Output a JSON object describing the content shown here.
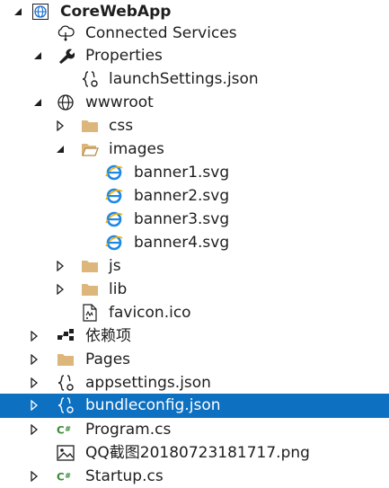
{
  "tree": {
    "project": {
      "label": "CoreWebApp",
      "icon": "globe-project-icon",
      "state": "expanded"
    },
    "connected_services": {
      "label": "Connected Services",
      "icon": "cloud-service-icon"
    },
    "properties": {
      "label": "Properties",
      "icon": "wrench-icon",
      "state": "expanded"
    },
    "launch_settings": {
      "label": "launchSettings.json",
      "icon": "json-file-icon"
    },
    "wwwroot": {
      "label": "wwwroot",
      "icon": "globe-icon",
      "state": "expanded"
    },
    "css": {
      "label": "css",
      "icon": "folder-icon",
      "state": "collapsed"
    },
    "images": {
      "label": "images",
      "icon": "folder-open-icon",
      "state": "expanded"
    },
    "banner1": {
      "label": "banner1.svg",
      "icon": "svg-file-icon"
    },
    "banner2": {
      "label": "banner2.svg",
      "icon": "svg-file-icon"
    },
    "banner3": {
      "label": "banner3.svg",
      "icon": "svg-file-icon"
    },
    "banner4": {
      "label": "banner4.svg",
      "icon": "svg-file-icon"
    },
    "js": {
      "label": "js",
      "icon": "folder-icon",
      "state": "collapsed"
    },
    "lib": {
      "label": "lib",
      "icon": "folder-icon",
      "state": "collapsed"
    },
    "favicon": {
      "label": "favicon.ico",
      "icon": "ico-file-icon"
    },
    "dependencies": {
      "label": "依赖项",
      "icon": "dependencies-icon",
      "state": "collapsed"
    },
    "pages": {
      "label": "Pages",
      "icon": "folder-icon",
      "state": "collapsed"
    },
    "appsettings": {
      "label": "appsettings.json",
      "icon": "json-file-icon",
      "state": "collapsed"
    },
    "bundleconfig": {
      "label": "bundleconfig.json",
      "icon": "json-file-icon",
      "state": "collapsed",
      "selected": true
    },
    "program": {
      "label": "Program.cs",
      "icon": "csharp-file-icon",
      "state": "collapsed"
    },
    "qq_image": {
      "label": "QQ截图20180723181717.png",
      "icon": "image-file-icon"
    },
    "startup": {
      "label": "Startup.cs",
      "icon": "csharp-file-icon",
      "state": "collapsed"
    }
  },
  "colors": {
    "selection": "#0e70c0",
    "folder": "#dcb67a",
    "globe": "#1e1e1e",
    "svg_file_blue": "#1e88e5",
    "csharp": "#388a34"
  }
}
